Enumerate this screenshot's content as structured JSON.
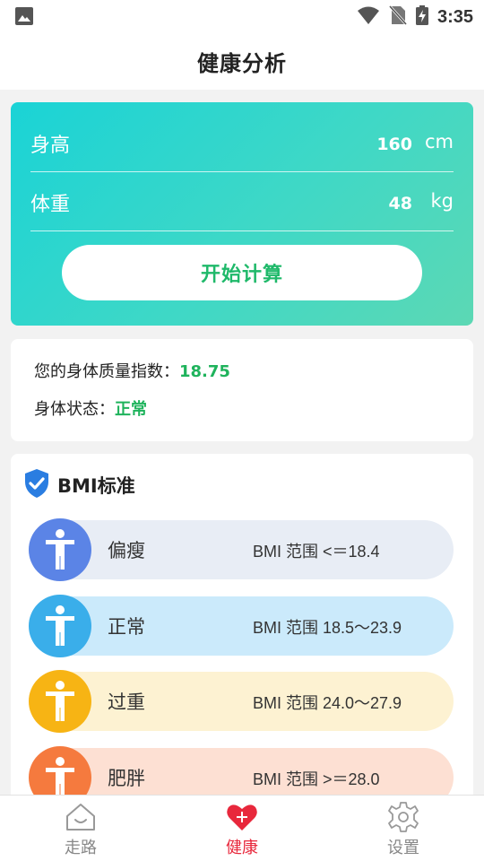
{
  "status_bar": {
    "time": "3:35"
  },
  "header": {
    "title": "健康分析"
  },
  "input": {
    "height": {
      "label": "身高",
      "value": "160",
      "unit": "cm"
    },
    "weight": {
      "label": "体重",
      "value": "48",
      "unit": "kg"
    },
    "calculate_label": "开始计算"
  },
  "result": {
    "bmi_label": "您的身体质量指数：",
    "bmi_value": "18.75",
    "status_label": "身体状态：",
    "status_value": "正常"
  },
  "standard": {
    "title": "BMI标准",
    "items": [
      {
        "label": "偏瘦",
        "range": "BMI 范围 <＝18.4",
        "avatar_color": "#5b84e6",
        "pill_color": "#e8edf5"
      },
      {
        "label": "正常",
        "range": "BMI 范围 18.5～23.9",
        "avatar_color": "#3aaeea",
        "pill_color": "#cbeafb"
      },
      {
        "label": "过重",
        "range": "BMI 范围 24.0～27.9",
        "avatar_color": "#f7b414",
        "pill_color": "#fdf2d2"
      },
      {
        "label": "肥胖",
        "range": "BMI 范围 >＝28.0",
        "avatar_color": "#f57a3e",
        "pill_color": "#fde0d3"
      }
    ]
  },
  "nav": {
    "walk": "走路",
    "health": "健康",
    "settings": "设置"
  },
  "colors": {
    "accent_green": "#1fb35c",
    "active_red": "#e8283c",
    "shield_blue": "#2a7de1"
  }
}
